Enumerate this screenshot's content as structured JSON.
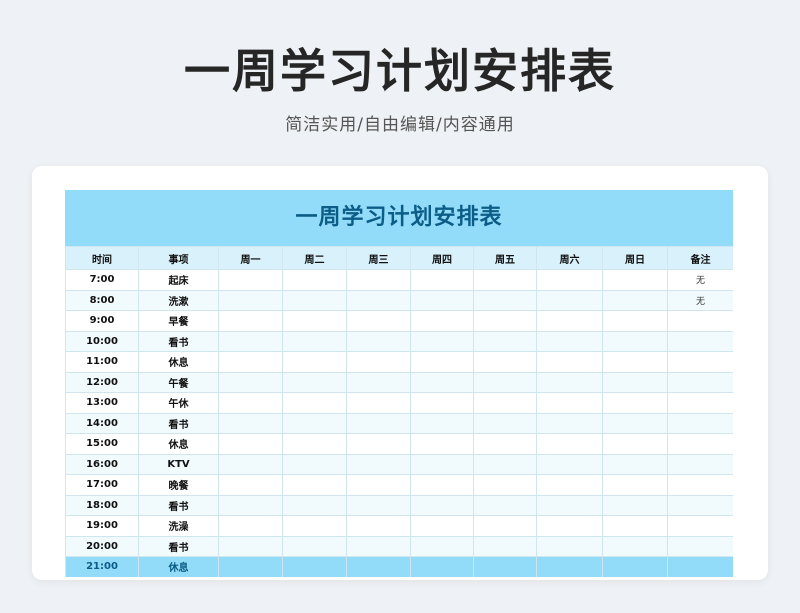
{
  "header": {
    "title": "一周学习计划安排表",
    "subtitle": "简洁实用/自由编辑/内容通用"
  },
  "sheet": {
    "title": "一周学习计划安排表",
    "columns": [
      "时间",
      "事项",
      "周一",
      "周二",
      "周三",
      "周四",
      "周五",
      "周六",
      "周日",
      "备注"
    ],
    "rows": [
      {
        "time": "7:00",
        "item": "起床",
        "note": "无"
      },
      {
        "time": "8:00",
        "item": "洗漱",
        "note": "无"
      },
      {
        "time": "9:00",
        "item": "早餐",
        "note": ""
      },
      {
        "time": "10:00",
        "item": "看书",
        "note": ""
      },
      {
        "time": "11:00",
        "item": "休息",
        "note": ""
      },
      {
        "time": "12:00",
        "item": "午餐",
        "note": ""
      },
      {
        "time": "13:00",
        "item": "午休",
        "note": ""
      },
      {
        "time": "14:00",
        "item": "看书",
        "note": ""
      },
      {
        "time": "15:00",
        "item": "休息",
        "note": ""
      },
      {
        "time": "16:00",
        "item": "KTV",
        "note": ""
      },
      {
        "time": "17:00",
        "item": "晚餐",
        "note": ""
      },
      {
        "time": "18:00",
        "item": "看书",
        "note": ""
      },
      {
        "time": "19:00",
        "item": "洗澡",
        "note": ""
      },
      {
        "time": "20:00",
        "item": "看书",
        "note": ""
      },
      {
        "time": "21:00",
        "item": "休息",
        "note": ""
      }
    ]
  }
}
